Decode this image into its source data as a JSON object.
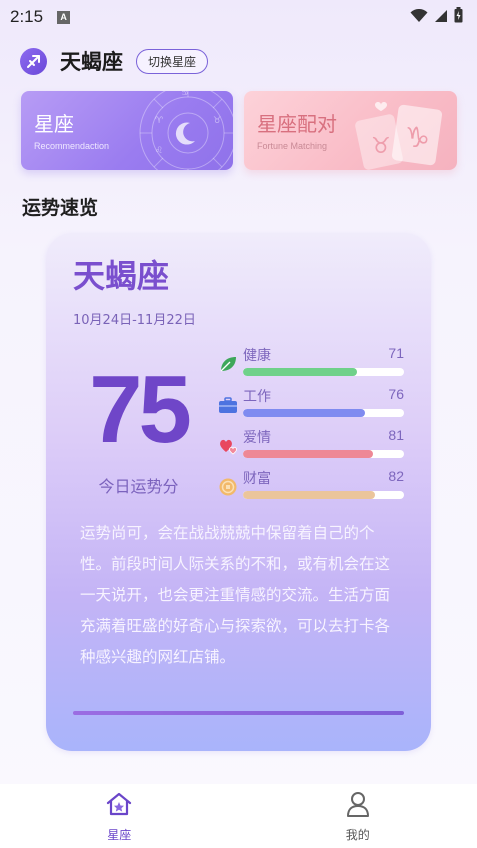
{
  "status_bar": {
    "time": "2:15",
    "indicator": "A"
  },
  "header": {
    "icon": "sagittarius-icon",
    "title": "天蝎座",
    "switch_label": "切换星座"
  },
  "cards": [
    {
      "title": "星座",
      "subtitle": "Recommendaction"
    },
    {
      "title": "星座配对",
      "subtitle": "Fortune Matching"
    }
  ],
  "section_title": "运势速览",
  "fortune": {
    "sign": "天蝎座",
    "date_range": "10月24日-11月22日",
    "score": "75",
    "score_label": "今日运势分",
    "metrics": [
      {
        "label": "健康",
        "value": "71",
        "fraction": 0.71,
        "color": "#6fd18a",
        "icon": "leaf-icon"
      },
      {
        "label": "工作",
        "value": "76",
        "fraction": 0.76,
        "color": "#7f8bf0",
        "icon": "briefcase-icon"
      },
      {
        "label": "爱情",
        "value": "81",
        "fraction": 0.81,
        "color": "#ee8896",
        "icon": "hearts-icon"
      },
      {
        "label": "财富",
        "value": "82",
        "fraction": 0.82,
        "color": "#ebc59b",
        "icon": "coin-icon"
      }
    ],
    "description": "运势尚可，会在战战兢兢中保留着自己的个性。前段时间人际关系的不和，或有机会在这一天说开，也会更注重情感的交流。生活方面充满着旺盛的好奇心与探索欲，可以去打卡各种感兴趣的网红店铺。"
  },
  "tabbar": {
    "tabs": [
      {
        "label": "星座",
        "active": true,
        "icon": "home-star-icon"
      },
      {
        "label": "我的",
        "active": false,
        "icon": "user-icon"
      }
    ]
  },
  "colors": {
    "accent": "#6f46c8",
    "active_tab": "#6a45c9"
  }
}
